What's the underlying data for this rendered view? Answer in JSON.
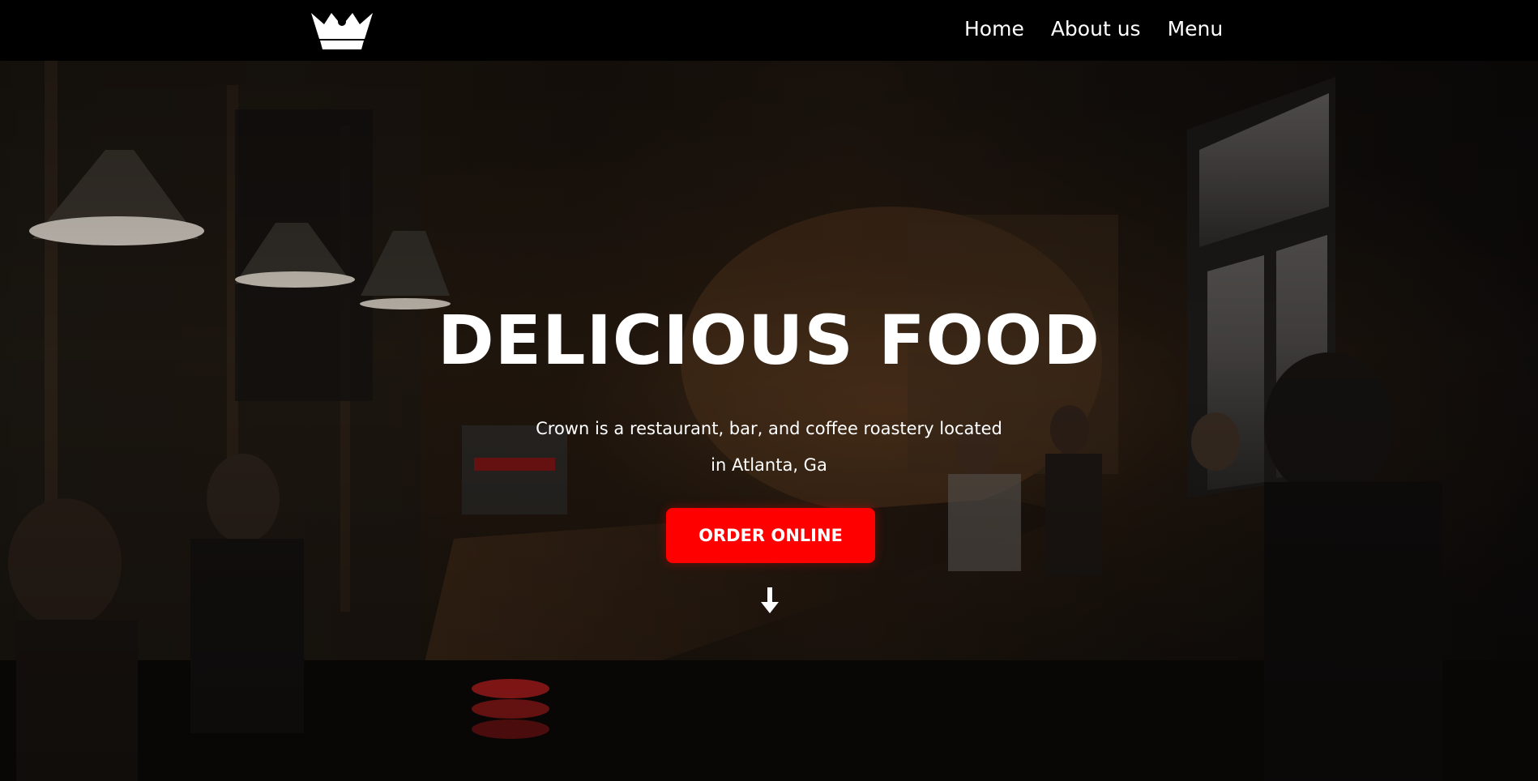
{
  "nav": {
    "logo_icon": "crown-icon",
    "links": [
      {
        "label": "Home"
      },
      {
        "label": "About us"
      },
      {
        "label": "Menu"
      }
    ]
  },
  "hero": {
    "background": "dark cafe interior photo",
    "title": "DELICIOUS FOOD",
    "description": "Crown is a restaurant, bar, and coffee roastery located in Atlanta, Ga",
    "cta_label": "ORDER ONLINE",
    "scroll_icon": "arrow-down-icon"
  },
  "colors": {
    "nav_bg": "#000000",
    "accent": "#ff0000",
    "text": "#ffffff"
  }
}
